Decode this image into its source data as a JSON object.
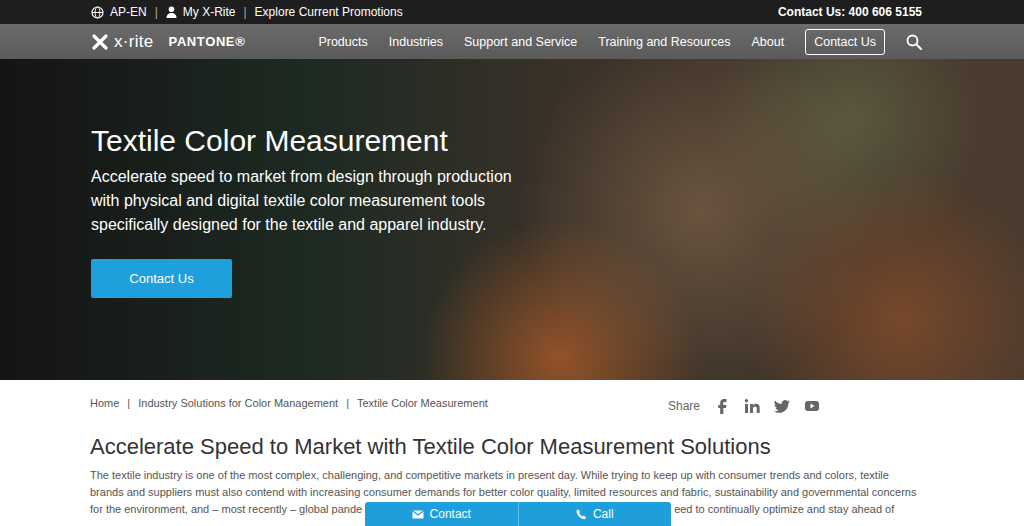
{
  "top_bar": {
    "region": "AP-EN",
    "account": "My X-Rite",
    "promotions": "Explore Current Promotions",
    "separator": "|",
    "contact": "Contact Us: 400 606 5155"
  },
  "logo": {
    "brand": "x·rite",
    "partner": "PANTONE®"
  },
  "nav": {
    "items": [
      "Products",
      "Industries",
      "Support and Service",
      "Training and Resources",
      "About"
    ],
    "contact_button": "Contact Us"
  },
  "hero": {
    "title": "Textile Color Measurement",
    "lines": [
      "Accelerate speed to market from design through production",
      "with physical and digital textile color measurement tools",
      "specifically designed for the textile and apparel industry."
    ],
    "button": "Contact Us"
  },
  "breadcrumb": {
    "items": [
      "Home",
      "Industry Solutions for Color Management",
      "Textile Color Measurement"
    ],
    "separator": "|"
  },
  "share": {
    "label": "Share"
  },
  "article": {
    "heading": "Accelerate Speed to Market with Textile Color Measurement Solutions",
    "lines": [
      "The textile industry is one of the most complex, challenging, and competitive markets in present day. While trying to keep up with consumer trends and colors, textile",
      "brands and suppliers must also contend with increasing consumer demands for better color quality, limited resources and fabric, sustainability and governmental concerns"
    ],
    "covered_line": {
      "before": "for the environment, and – most recently – global pande",
      "after": "eed to continually optimize and stay ahead of"
    }
  },
  "float_bar": {
    "contact": "Contact",
    "call": "Call"
  }
}
